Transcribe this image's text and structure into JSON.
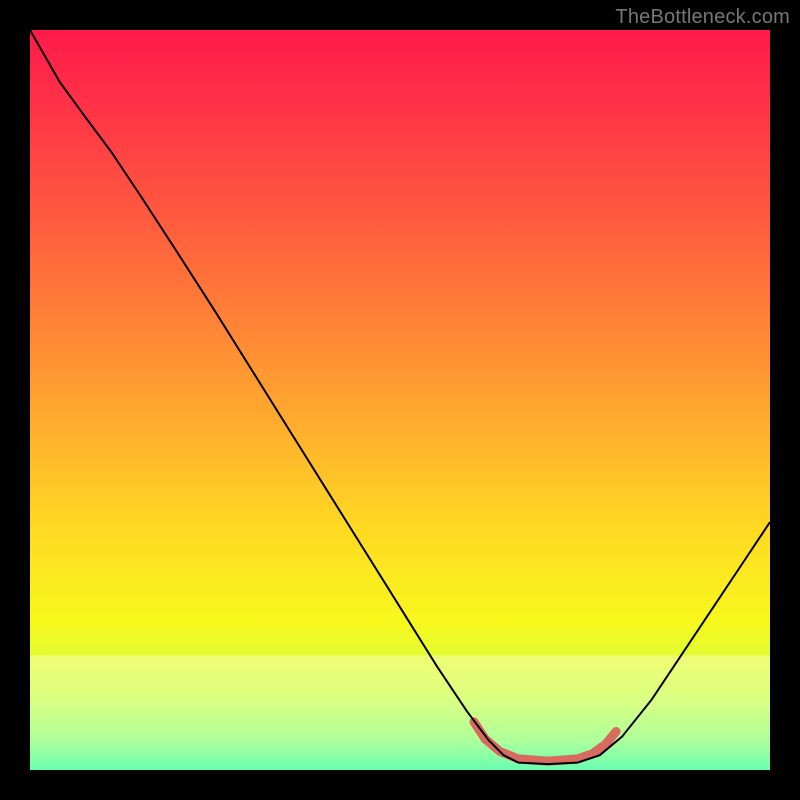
{
  "watermark": "TheBottleneck.com",
  "chart_data": {
    "type": "line",
    "title": "",
    "xlabel": "",
    "ylabel": "",
    "xlim": [
      0,
      1
    ],
    "ylim": [
      0,
      1
    ],
    "grid": false,
    "legend": false,
    "gradient_stops": [
      {
        "offset": 0.0,
        "color": "#ff1a4b"
      },
      {
        "offset": 0.1,
        "color": "#ff3247"
      },
      {
        "offset": 0.25,
        "color": "#ff593f"
      },
      {
        "offset": 0.4,
        "color": "#ff8436"
      },
      {
        "offset": 0.55,
        "color": "#ffb22c"
      },
      {
        "offset": 0.68,
        "color": "#ffdb22"
      },
      {
        "offset": 0.8,
        "color": "#f7f81c"
      },
      {
        "offset": 0.9,
        "color": "#ccff4a"
      },
      {
        "offset": 0.96,
        "color": "#8bff7a"
      },
      {
        "offset": 1.0,
        "color": "#2bff9a"
      }
    ],
    "pale_band": {
      "y_top": 0.845,
      "color_top": "#faffa8",
      "color_bottom": "#d9ffd9"
    },
    "series": [
      {
        "name": "curve",
        "stroke": "#000000",
        "width": 2,
        "points": [
          {
            "x": 0.0,
            "y": 0.0
          },
          {
            "x": 0.04,
            "y": 0.07
          },
          {
            "x": 0.075,
            "y": 0.118
          },
          {
            "x": 0.11,
            "y": 0.165
          },
          {
            "x": 0.15,
            "y": 0.225
          },
          {
            "x": 0.2,
            "y": 0.302
          },
          {
            "x": 0.25,
            "y": 0.38
          },
          {
            "x": 0.3,
            "y": 0.46
          },
          {
            "x": 0.35,
            "y": 0.54
          },
          {
            "x": 0.4,
            "y": 0.62
          },
          {
            "x": 0.45,
            "y": 0.7
          },
          {
            "x": 0.5,
            "y": 0.78
          },
          {
            "x": 0.55,
            "y": 0.86
          },
          {
            "x": 0.59,
            "y": 0.92
          },
          {
            "x": 0.62,
            "y": 0.96
          },
          {
            "x": 0.64,
            "y": 0.98
          },
          {
            "x": 0.66,
            "y": 0.99
          },
          {
            "x": 0.7,
            "y": 0.992
          },
          {
            "x": 0.74,
            "y": 0.99
          },
          {
            "x": 0.77,
            "y": 0.98
          },
          {
            "x": 0.8,
            "y": 0.955
          },
          {
            "x": 0.84,
            "y": 0.905
          },
          {
            "x": 0.88,
            "y": 0.845
          },
          {
            "x": 0.92,
            "y": 0.785
          },
          {
            "x": 0.96,
            "y": 0.725
          },
          {
            "x": 1.0,
            "y": 0.665
          }
        ]
      },
      {
        "name": "bottom-highlight",
        "stroke": "#d86a60",
        "width": 9,
        "linecap": "round",
        "points": [
          {
            "x": 0.6,
            "y": 0.935
          },
          {
            "x": 0.615,
            "y": 0.958
          },
          {
            "x": 0.635,
            "y": 0.975
          },
          {
            "x": 0.66,
            "y": 0.985
          },
          {
            "x": 0.7,
            "y": 0.988
          },
          {
            "x": 0.74,
            "y": 0.985
          },
          {
            "x": 0.76,
            "y": 0.978
          },
          {
            "x": 0.778,
            "y": 0.965
          },
          {
            "x": 0.792,
            "y": 0.948
          }
        ]
      }
    ]
  }
}
